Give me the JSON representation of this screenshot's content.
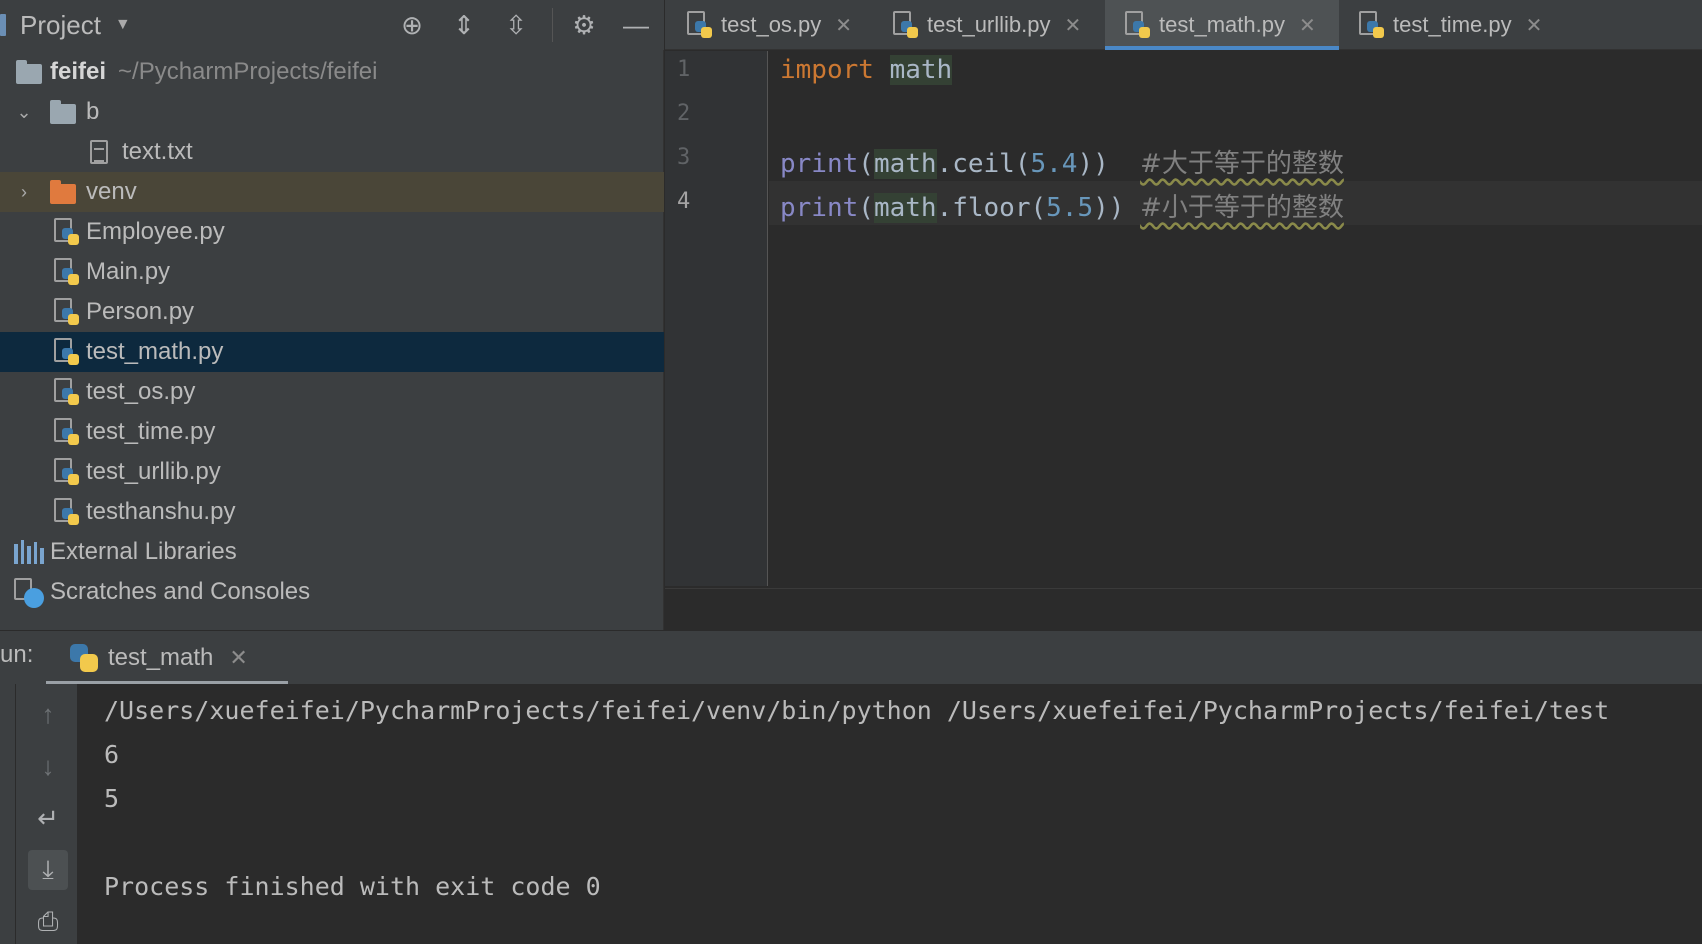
{
  "project_panel": {
    "title": "Project",
    "toolbar_icons": [
      "locate-icon",
      "expand-all-icon",
      "collapse-all-icon",
      "gear-icon",
      "hide-icon"
    ],
    "root": {
      "name": "feifei",
      "path": "~/PycharmProjects/feifei"
    },
    "items": [
      {
        "name": "b",
        "type": "folder",
        "expanded": true
      },
      {
        "name": "text.txt",
        "type": "text-file"
      },
      {
        "name": "venv",
        "type": "folder",
        "expanded": false
      },
      {
        "name": "Employee.py",
        "type": "python-file"
      },
      {
        "name": "Main.py",
        "type": "python-file"
      },
      {
        "name": "Person.py",
        "type": "python-file"
      },
      {
        "name": "test_math.py",
        "type": "python-file",
        "selected": true
      },
      {
        "name": "test_os.py",
        "type": "python-file"
      },
      {
        "name": "test_time.py",
        "type": "python-file"
      },
      {
        "name": "test_urllib.py",
        "type": "python-file"
      },
      {
        "name": "testhanshu.py",
        "type": "python-file"
      }
    ],
    "external_libraries": "External Libraries",
    "scratches": "Scratches and Consoles"
  },
  "editor": {
    "tabs": [
      {
        "label": "test_os.py",
        "active": false
      },
      {
        "label": "test_urllib.py",
        "active": false
      },
      {
        "label": "test_math.py",
        "active": true
      },
      {
        "label": "test_time.py",
        "active": false
      }
    ],
    "line_numbers": [
      "1",
      "2",
      "3",
      "4"
    ],
    "code": {
      "line1": {
        "keyword": "import",
        "module": "math"
      },
      "line3": {
        "fn": "print",
        "obj": "math",
        "method": ".ceil",
        "num": "5.4",
        "comment": "#大于等于的整数"
      },
      "line4": {
        "fn": "print",
        "obj": "math",
        "method": ".floor",
        "num": "5.5",
        "comment": "#小于等于的整数"
      }
    }
  },
  "run_panel": {
    "label": "un:",
    "tab_label": "test_math",
    "console_lines": [
      "/Users/xuefeifei/PycharmProjects/feifei/venv/bin/python /Users/xuefeifei/PycharmProjects/feifei/test",
      "6",
      "5",
      "",
      "Process finished with exit code 0"
    ]
  },
  "colors": {
    "panel_bg": "#3c3f41",
    "editor_bg": "#2b2b2b",
    "selection": "#0d293e",
    "keyword": "#cc7832",
    "builtin": "#8888c6",
    "number": "#6897bb",
    "tab_underline": "#4a88c7"
  }
}
